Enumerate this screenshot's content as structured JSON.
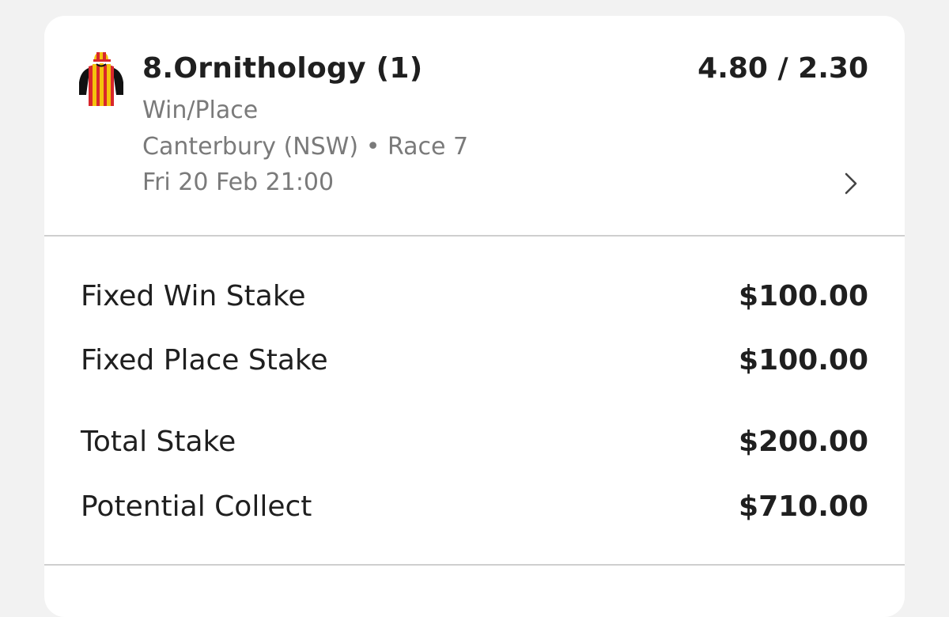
{
  "bet": {
    "runner": "8.Ornithology (1)",
    "odds": "4.80 / 2.30",
    "bet_type": "Win/Place",
    "venue": "Canterbury (NSW)",
    "separator": "•",
    "race": "Race 7",
    "datetime": "Fri 20 Feb 21:00",
    "silks_icon": "jockey-silks-icon",
    "chevron_icon": "chevron-right-icon"
  },
  "stakes": [
    {
      "label": "Fixed Win Stake",
      "value": "$100.00"
    },
    {
      "label": "Fixed Place Stake",
      "value": "$100.00"
    }
  ],
  "totals": [
    {
      "label": "Total Stake",
      "value": "$200.00"
    },
    {
      "label": "Potential Collect",
      "value": "$710.00"
    }
  ],
  "colors": {
    "background": "#f2f2f2",
    "card": "#ffffff",
    "text_primary": "#1f1f1f",
    "text_secondary": "#7a7a7a",
    "divider": "#cfcfcf",
    "silks_red": "#d8262c",
    "silks_yellow": "#f4c20d",
    "silks_black": "#111111"
  }
}
